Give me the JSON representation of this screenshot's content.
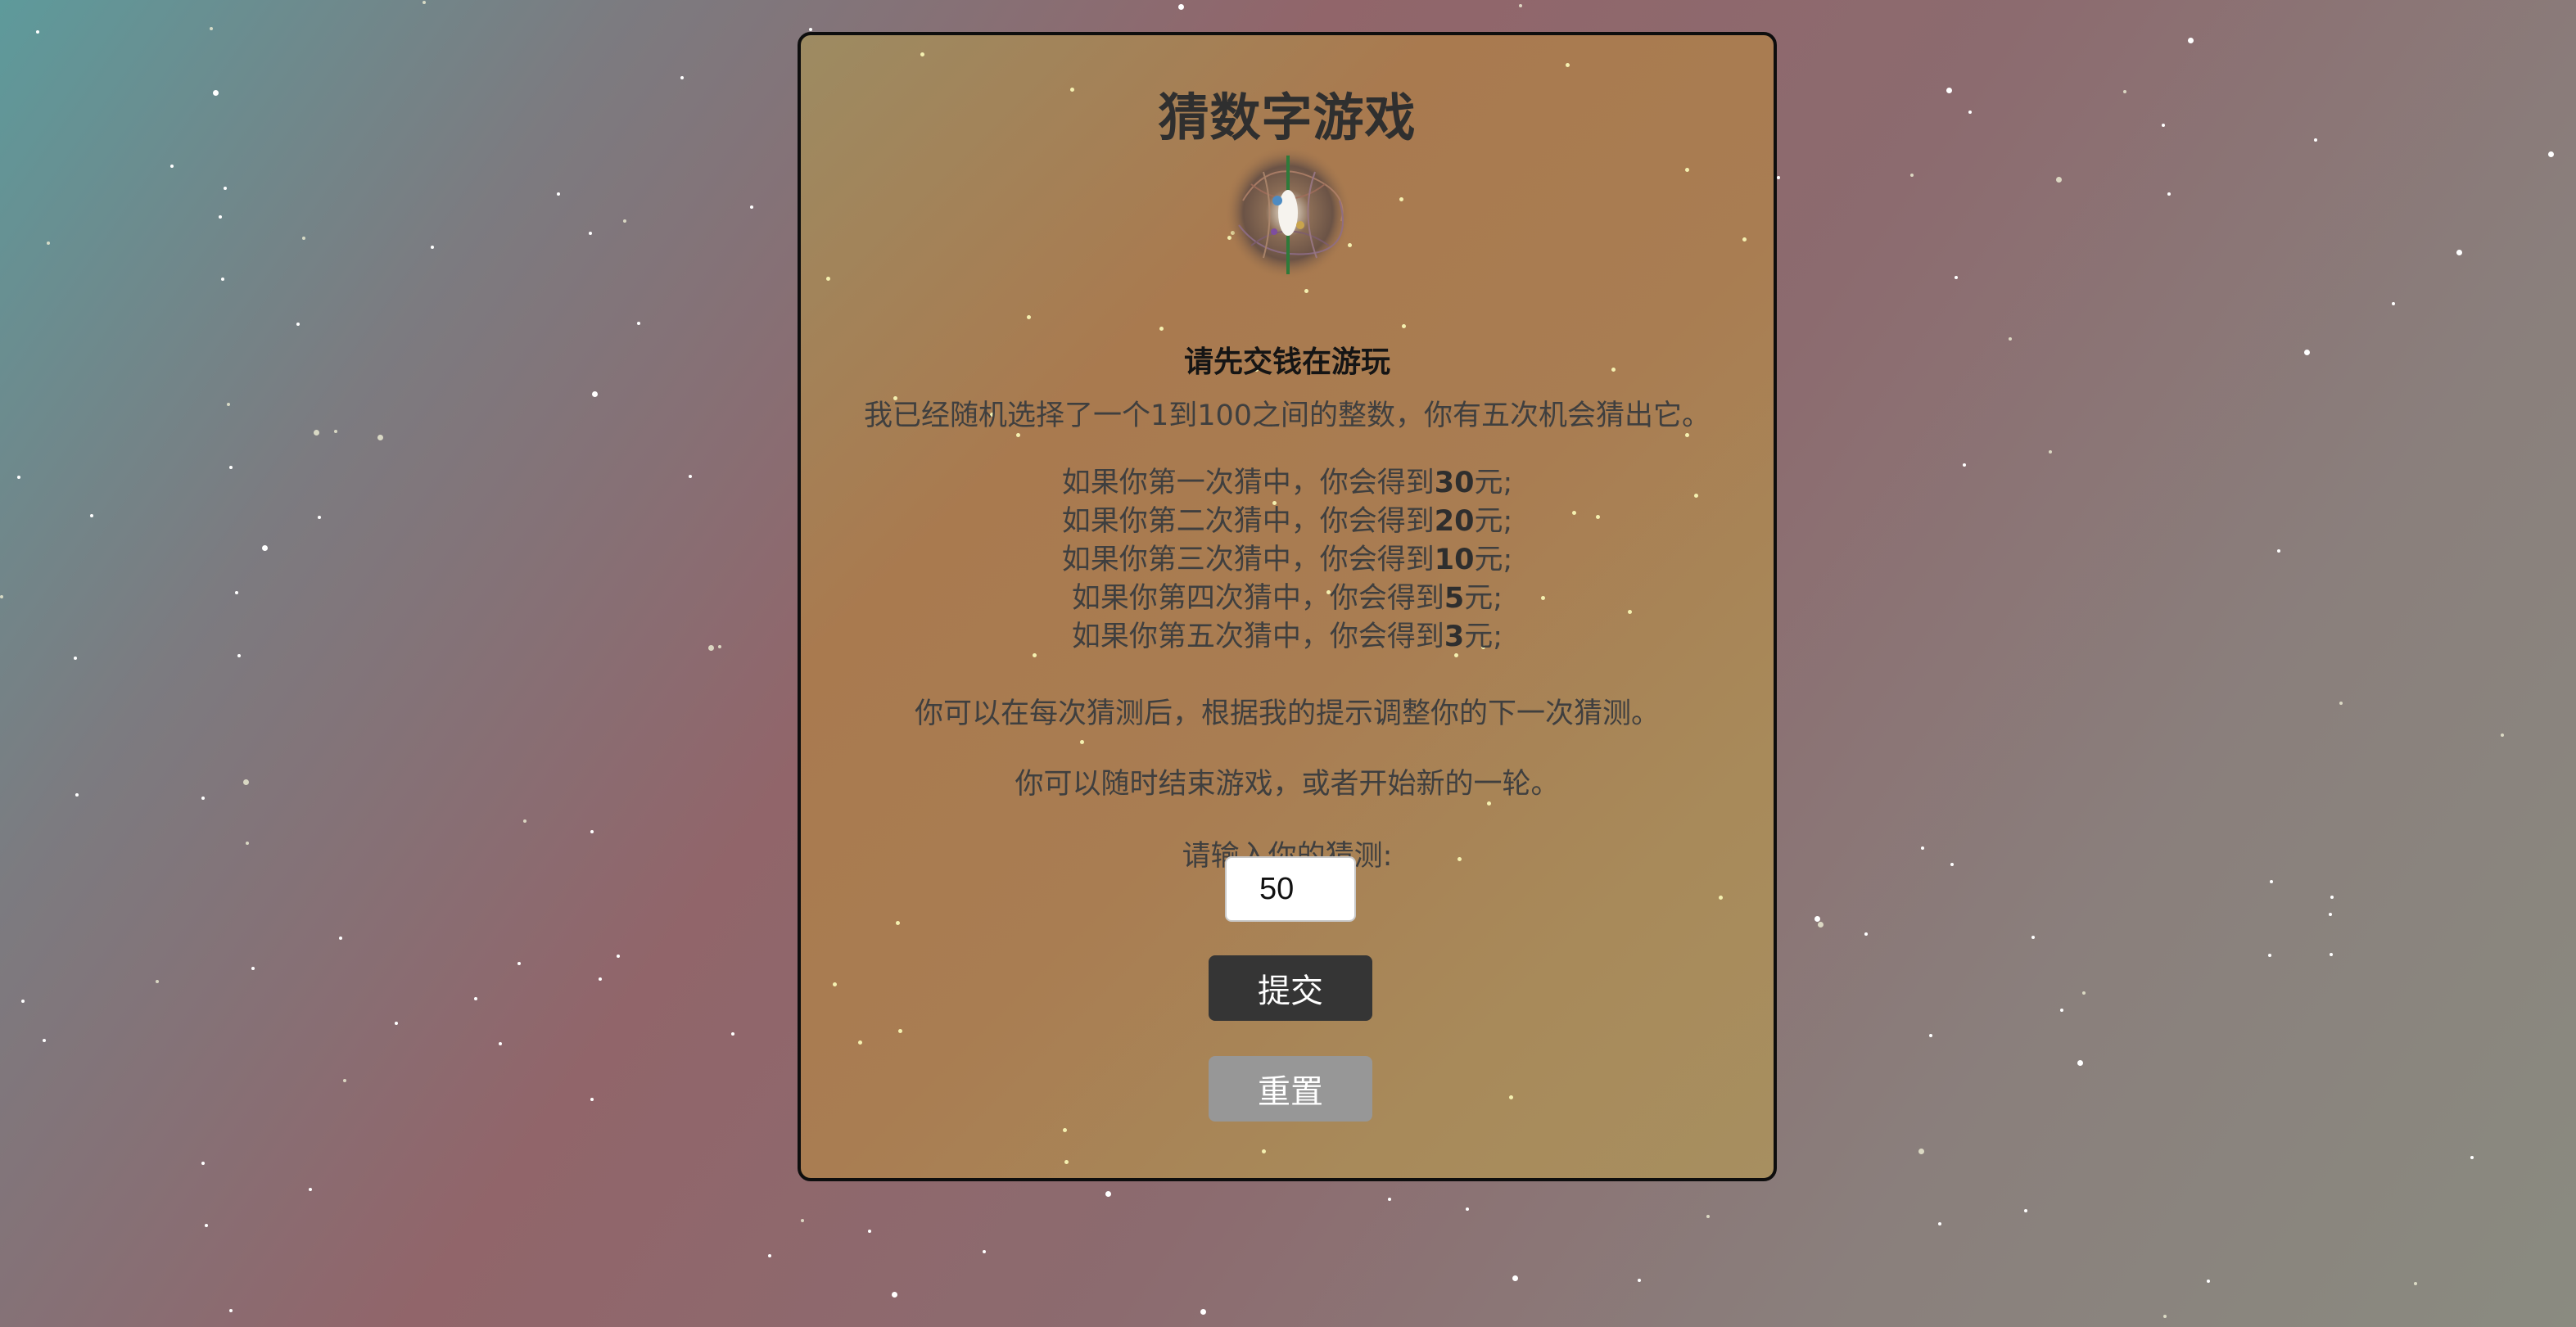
{
  "game": {
    "title": "猜数字游戏",
    "logo_icon": "galaxy-emblem-icon",
    "notice": "请先交钱在游玩",
    "intro": "我已经随机选择了一个1到100之间的整数，你有五次机会猜出它。",
    "rewards": [
      {
        "prefix": "如果你第一次猜中，你会得到",
        "amount": "30",
        "suffix": "元;"
      },
      {
        "prefix": "如果你第二次猜中，你会得到",
        "amount": "20",
        "suffix": "元;"
      },
      {
        "prefix": "如果你第三次猜中，你会得到",
        "amount": "10",
        "suffix": "元;"
      },
      {
        "prefix": "如果你第四次猜中，你会得到",
        "amount": "5",
        "suffix": "元;"
      },
      {
        "prefix": "如果你第五次猜中，你会得到",
        "amount": "3",
        "suffix": "元;"
      }
    ],
    "tip_adjust": "你可以在每次猜测后，根据我的提示调整你的下一次猜测。",
    "tip_end": "你可以随时结束游戏，或者开始新的一轮。",
    "guess_prompt": "请输入你的猜测:",
    "guess_value": "50",
    "submit_label": "提交",
    "reset_label": "重置"
  },
  "colors": {
    "card_border": "#0e0e0e",
    "submit_button": "#353535",
    "reset_button": "#979797",
    "star": "#ffffff"
  }
}
